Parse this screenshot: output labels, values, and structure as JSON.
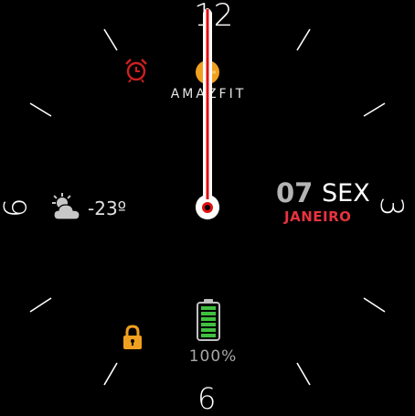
{
  "dial": {
    "numeral_12": "12",
    "numeral_3": "3",
    "numeral_6": "6",
    "numeral_9": "9"
  },
  "brand": "AMAZFIT",
  "weather": {
    "icon": "partly-cloudy-icon",
    "temperature": "-23º"
  },
  "date": {
    "day": "07",
    "weekday": "SEX",
    "month": "JANEIRO"
  },
  "battery": {
    "icon": "battery-icon",
    "percent": "100%",
    "level": 1.0
  },
  "status_icons": [
    "alarm-icon",
    "sun-icon",
    "lock-icon"
  ],
  "colors": {
    "background": "#000000",
    "alarm": "#cc2020",
    "accent_orange": "#f0a020",
    "battery_green": "#40c040",
    "hand_red": "#e01010",
    "month_red": "#e8323f"
  }
}
